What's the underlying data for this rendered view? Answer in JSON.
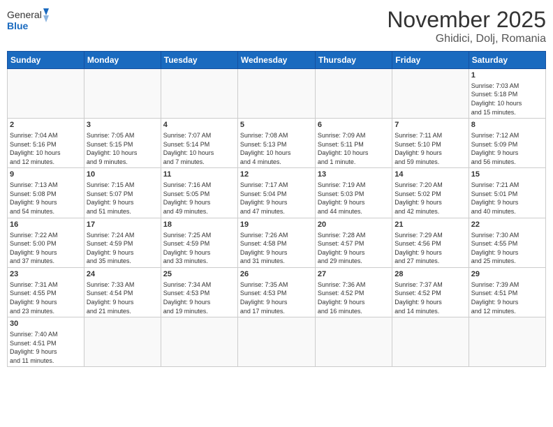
{
  "logo": {
    "general": "General",
    "blue": "Blue"
  },
  "title": "November 2025",
  "location": "Ghidici, Dolj, Romania",
  "days_header": [
    "Sunday",
    "Monday",
    "Tuesday",
    "Wednesday",
    "Thursday",
    "Friday",
    "Saturday"
  ],
  "weeks": [
    [
      {
        "day": "",
        "info": ""
      },
      {
        "day": "",
        "info": ""
      },
      {
        "day": "",
        "info": ""
      },
      {
        "day": "",
        "info": ""
      },
      {
        "day": "",
        "info": ""
      },
      {
        "day": "",
        "info": ""
      },
      {
        "day": "1",
        "info": "Sunrise: 7:03 AM\nSunset: 5:18 PM\nDaylight: 10 hours\nand 15 minutes."
      }
    ],
    [
      {
        "day": "2",
        "info": "Sunrise: 7:04 AM\nSunset: 5:16 PM\nDaylight: 10 hours\nand 12 minutes."
      },
      {
        "day": "3",
        "info": "Sunrise: 7:05 AM\nSunset: 5:15 PM\nDaylight: 10 hours\nand 9 minutes."
      },
      {
        "day": "4",
        "info": "Sunrise: 7:07 AM\nSunset: 5:14 PM\nDaylight: 10 hours\nand 7 minutes."
      },
      {
        "day": "5",
        "info": "Sunrise: 7:08 AM\nSunset: 5:13 PM\nDaylight: 10 hours\nand 4 minutes."
      },
      {
        "day": "6",
        "info": "Sunrise: 7:09 AM\nSunset: 5:11 PM\nDaylight: 10 hours\nand 1 minute."
      },
      {
        "day": "7",
        "info": "Sunrise: 7:11 AM\nSunset: 5:10 PM\nDaylight: 9 hours\nand 59 minutes."
      },
      {
        "day": "8",
        "info": "Sunrise: 7:12 AM\nSunset: 5:09 PM\nDaylight: 9 hours\nand 56 minutes."
      }
    ],
    [
      {
        "day": "9",
        "info": "Sunrise: 7:13 AM\nSunset: 5:08 PM\nDaylight: 9 hours\nand 54 minutes."
      },
      {
        "day": "10",
        "info": "Sunrise: 7:15 AM\nSunset: 5:07 PM\nDaylight: 9 hours\nand 51 minutes."
      },
      {
        "day": "11",
        "info": "Sunrise: 7:16 AM\nSunset: 5:05 PM\nDaylight: 9 hours\nand 49 minutes."
      },
      {
        "day": "12",
        "info": "Sunrise: 7:17 AM\nSunset: 5:04 PM\nDaylight: 9 hours\nand 47 minutes."
      },
      {
        "day": "13",
        "info": "Sunrise: 7:19 AM\nSunset: 5:03 PM\nDaylight: 9 hours\nand 44 minutes."
      },
      {
        "day": "14",
        "info": "Sunrise: 7:20 AM\nSunset: 5:02 PM\nDaylight: 9 hours\nand 42 minutes."
      },
      {
        "day": "15",
        "info": "Sunrise: 7:21 AM\nSunset: 5:01 PM\nDaylight: 9 hours\nand 40 minutes."
      }
    ],
    [
      {
        "day": "16",
        "info": "Sunrise: 7:22 AM\nSunset: 5:00 PM\nDaylight: 9 hours\nand 37 minutes."
      },
      {
        "day": "17",
        "info": "Sunrise: 7:24 AM\nSunset: 4:59 PM\nDaylight: 9 hours\nand 35 minutes."
      },
      {
        "day": "18",
        "info": "Sunrise: 7:25 AM\nSunset: 4:59 PM\nDaylight: 9 hours\nand 33 minutes."
      },
      {
        "day": "19",
        "info": "Sunrise: 7:26 AM\nSunset: 4:58 PM\nDaylight: 9 hours\nand 31 minutes."
      },
      {
        "day": "20",
        "info": "Sunrise: 7:28 AM\nSunset: 4:57 PM\nDaylight: 9 hours\nand 29 minutes."
      },
      {
        "day": "21",
        "info": "Sunrise: 7:29 AM\nSunset: 4:56 PM\nDaylight: 9 hours\nand 27 minutes."
      },
      {
        "day": "22",
        "info": "Sunrise: 7:30 AM\nSunset: 4:55 PM\nDaylight: 9 hours\nand 25 minutes."
      }
    ],
    [
      {
        "day": "23",
        "info": "Sunrise: 7:31 AM\nSunset: 4:55 PM\nDaylight: 9 hours\nand 23 minutes."
      },
      {
        "day": "24",
        "info": "Sunrise: 7:33 AM\nSunset: 4:54 PM\nDaylight: 9 hours\nand 21 minutes."
      },
      {
        "day": "25",
        "info": "Sunrise: 7:34 AM\nSunset: 4:53 PM\nDaylight: 9 hours\nand 19 minutes."
      },
      {
        "day": "26",
        "info": "Sunrise: 7:35 AM\nSunset: 4:53 PM\nDaylight: 9 hours\nand 17 minutes."
      },
      {
        "day": "27",
        "info": "Sunrise: 7:36 AM\nSunset: 4:52 PM\nDaylight: 9 hours\nand 16 minutes."
      },
      {
        "day": "28",
        "info": "Sunrise: 7:37 AM\nSunset: 4:52 PM\nDaylight: 9 hours\nand 14 minutes."
      },
      {
        "day": "29",
        "info": "Sunrise: 7:39 AM\nSunset: 4:51 PM\nDaylight: 9 hours\nand 12 minutes."
      }
    ],
    [
      {
        "day": "30",
        "info": "Sunrise: 7:40 AM\nSunset: 4:51 PM\nDaylight: 9 hours\nand 11 minutes."
      },
      {
        "day": "",
        "info": ""
      },
      {
        "day": "",
        "info": ""
      },
      {
        "day": "",
        "info": ""
      },
      {
        "day": "",
        "info": ""
      },
      {
        "day": "",
        "info": ""
      },
      {
        "day": "",
        "info": ""
      }
    ]
  ]
}
